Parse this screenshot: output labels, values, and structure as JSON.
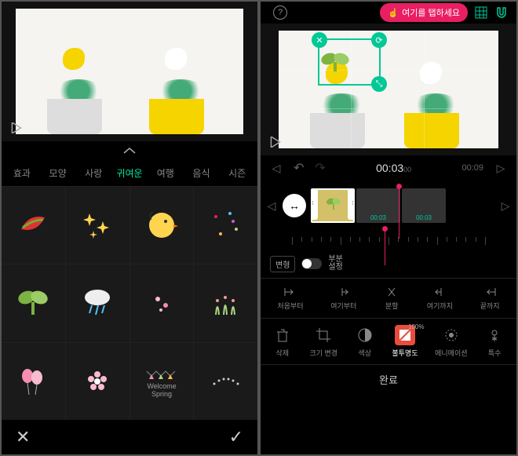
{
  "left": {
    "tabs": [
      "효과",
      "모양",
      "사랑",
      "귀여운",
      "여행",
      "음식",
      "시즌"
    ],
    "active_tab": 3,
    "stickers": [
      {
        "name": "leaf"
      },
      {
        "name": "sparkle"
      },
      {
        "name": "chick"
      },
      {
        "name": "confetti"
      },
      {
        "name": "sprout"
      },
      {
        "name": "cloud-rain"
      },
      {
        "name": "petals"
      },
      {
        "name": "grass"
      },
      {
        "name": "balloons"
      },
      {
        "name": "blossom"
      },
      {
        "name": "welcome-spring",
        "text": "Welcome\nSpring"
      },
      {
        "name": "dots"
      }
    ],
    "bottom": {
      "cancel": "✕",
      "confirm": "✓"
    }
  },
  "right": {
    "hint": "여기를 탭하세요",
    "sticker_handles": {
      "close": "✕",
      "rotate": "⟳",
      "resize": "⤡"
    },
    "time": {
      "current": "00:03",
      "current_sub": "00",
      "end": "00:09"
    },
    "clips": [
      {
        "dur": "",
        "sel": true
      },
      {
        "dur": "00:03",
        "sel": false
      },
      {
        "dur": "00:03",
        "sel": false
      }
    ],
    "transform": {
      "label": "변형",
      "sub": "부분\n설정"
    },
    "split_btns": [
      {
        "label": "처음부터",
        "icon": "from-start"
      },
      {
        "label": "여기부터",
        "icon": "from-here"
      },
      {
        "label": "분할",
        "icon": "split"
      },
      {
        "label": "여기까지",
        "icon": "to-here"
      },
      {
        "label": "끝까지",
        "icon": "to-end"
      }
    ],
    "actions": [
      {
        "label": "삭제",
        "icon": "trash"
      },
      {
        "label": "크기 변경",
        "icon": "crop"
      },
      {
        "label": "색상",
        "icon": "color"
      },
      {
        "label": "불투명도",
        "icon": "opacity",
        "active": true,
        "pct": "100%"
      },
      {
        "label": "에니메이션",
        "icon": "animation"
      },
      {
        "label": "특수",
        "icon": "fx"
      }
    ],
    "done": "완료"
  }
}
